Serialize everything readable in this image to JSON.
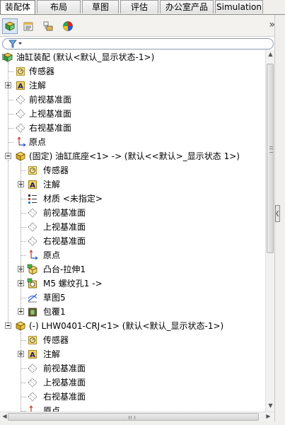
{
  "tabs": [
    {
      "label": "装配体",
      "active": true
    },
    {
      "label": "布局",
      "active": false
    },
    {
      "label": "草图",
      "active": false
    },
    {
      "label": "评估",
      "active": false
    },
    {
      "label": "办公室产品",
      "active": false
    },
    {
      "label": "Simulation",
      "active": false
    }
  ],
  "toolbar": {
    "buttons": [
      {
        "icon": "featuremanager-tree-icon",
        "active": true
      },
      {
        "icon": "property-manager-icon",
        "active": false
      },
      {
        "icon": "configuration-manager-icon",
        "active": false
      },
      {
        "icon": "display-manager-icon",
        "active": false
      }
    ],
    "overflow_glyph": "»"
  },
  "filter": {
    "icon": "filter-icon"
  },
  "tree": [
    {
      "level": 0,
      "toggle": "minus",
      "icon": "assembly-icon",
      "label": "油缸装配  (默认<默认_显示状态-1>)"
    },
    {
      "level": 1,
      "toggle": "none",
      "icon": "sensor-icon",
      "label": "传感器"
    },
    {
      "level": 1,
      "toggle": "plus",
      "icon": "annotation-icon",
      "label": "注解"
    },
    {
      "level": 1,
      "toggle": "none",
      "icon": "plane-icon",
      "label": "前视基准面"
    },
    {
      "level": 1,
      "toggle": "none",
      "icon": "plane-icon",
      "label": "上视基准面"
    },
    {
      "level": 1,
      "toggle": "none",
      "icon": "plane-icon",
      "label": "右视基准面"
    },
    {
      "level": 1,
      "toggle": "none",
      "icon": "origin-icon",
      "label": "原点"
    },
    {
      "level": 1,
      "toggle": "minus",
      "icon": "part-icon",
      "label": "(固定) 油缸底座<1> -> (默认<<默认>_显示状态 1>)"
    },
    {
      "level": 2,
      "toggle": "none",
      "icon": "sensor-icon",
      "label": "传感器"
    },
    {
      "level": 2,
      "toggle": "plus",
      "icon": "annotation-icon",
      "label": "注解"
    },
    {
      "level": 2,
      "toggle": "none",
      "icon": "material-icon",
      "label": "材质 <未指定>"
    },
    {
      "level": 2,
      "toggle": "none",
      "icon": "plane-icon",
      "label": "前视基准面"
    },
    {
      "level": 2,
      "toggle": "none",
      "icon": "plane-icon",
      "label": "上视基准面"
    },
    {
      "level": 2,
      "toggle": "none",
      "icon": "plane-icon",
      "label": "右视基准面"
    },
    {
      "level": 2,
      "toggle": "none",
      "icon": "origin-icon",
      "label": "原点"
    },
    {
      "level": 2,
      "toggle": "plus",
      "icon": "boss-extrude-icon",
      "label": "凸台-拉伸1"
    },
    {
      "level": 2,
      "toggle": "plus",
      "icon": "hole-wizard-icon",
      "label": "M5 螺纹孔1 ->"
    },
    {
      "level": 2,
      "toggle": "none",
      "icon": "sketch-icon",
      "label": "草图5"
    },
    {
      "level": 2,
      "toggle": "plus",
      "icon": "wrap-icon",
      "label": "包覆1"
    },
    {
      "level": 1,
      "toggle": "minus",
      "icon": "part-icon",
      "label": "(-) LHW0401-CRJ<1> (默认<默认_显示状态-1>)"
    },
    {
      "level": 2,
      "toggle": "none",
      "icon": "sensor-icon",
      "label": "传感器"
    },
    {
      "level": 2,
      "toggle": "plus",
      "icon": "annotation-icon",
      "label": "注解"
    },
    {
      "level": 2,
      "toggle": "none",
      "icon": "plane-icon",
      "label": "前视基准面"
    },
    {
      "level": 2,
      "toggle": "none",
      "icon": "plane-icon",
      "label": "上视基准面"
    },
    {
      "level": 2,
      "toggle": "none",
      "icon": "plane-icon",
      "label": "右视基准面"
    },
    {
      "level": 2,
      "toggle": "none",
      "icon": "origin-icon",
      "label": "原点"
    }
  ],
  "scrollbars": {
    "vertical": "vertical-scrollbar",
    "horizontal": "horizontal-scrollbar"
  }
}
